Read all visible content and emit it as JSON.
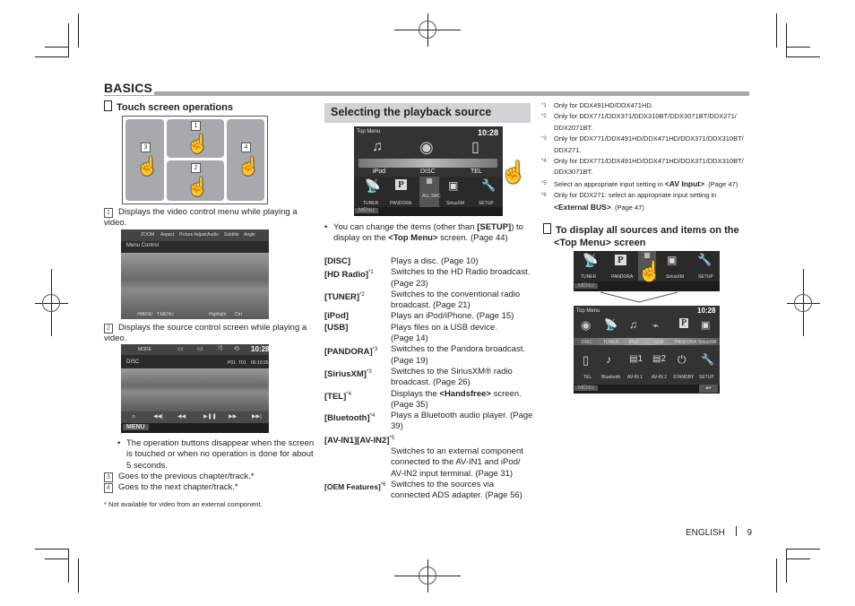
{
  "section_title": "BASICS",
  "touch": {
    "heading": "Touch screen operations",
    "zone_labels": [
      "1",
      "2",
      "3",
      "4"
    ],
    "items": [
      {
        "num": "1",
        "text": "Displays the video control menu while playing a video."
      },
      {
        "num": "2",
        "text": "Displays the source control screen while playing a video."
      },
      {
        "num": "3",
        "text": "Goes to the previous chapter/track.*"
      },
      {
        "num": "4",
        "text": "Goes to the next chapter/track.*"
      }
    ],
    "bullet": "The operation buttons disappear when the screen is touched or when no operation is done for about 5 seconds.",
    "footnote": "* Not available for video from an external component.",
    "video_menu_screen": {
      "tabs": [
        "ZOOM",
        "Aspect",
        "Picture Adjust",
        "Audio",
        "Subtitle",
        "Angle"
      ],
      "title": "Menu Control",
      "bottom": [
        "#MENU",
        "T.MENU",
        "Highlight",
        "Ctrl"
      ]
    },
    "source_screen": {
      "mode_label": "MODE",
      "clock": "10:28",
      "source": "DISC",
      "status": [
        "P01",
        "T01",
        "00:10:25"
      ],
      "menu_label": "MENU",
      "controls": [
        "search",
        "prev-track",
        "rewind",
        "play-pause",
        "fast-forward",
        "next-track"
      ]
    }
  },
  "playback": {
    "heading": "Selecting the playback source",
    "screen": {
      "title": "Top Menu",
      "clock": "10:28",
      "top_items": [
        "iPod",
        "DISC",
        "TEL"
      ],
      "bottom_items": [
        "TUNER",
        "PANDORA",
        "ALL SRC",
        "SiriusXM",
        "SETUP"
      ],
      "menu_label": "MENU"
    },
    "note_parts": [
      "You can change the items (other than ",
      "[SETUP]",
      ") to display on the ",
      "<Top Menu>",
      " screen. (Page 44)"
    ],
    "definitions": [
      {
        "term": "[DISC]",
        "mark": "",
        "desc": "Plays a disc. (Page 10)"
      },
      {
        "term": "[HD Radio]",
        "mark": "*1",
        "desc": "Switches to the HD Radio broadcast. (Page 23)"
      },
      {
        "term": "[TUNER]",
        "mark": "*2",
        "desc": "Switches to the conventional radio broadcast. (Page 21)"
      },
      {
        "term": "[iPod]",
        "mark": "",
        "desc": "Plays an iPod/iPhone. (Page 15)"
      },
      {
        "term": "[USB]",
        "mark": "",
        "desc": "Plays files on a USB device. (Page 14)"
      },
      {
        "term": "[PANDORA]",
        "mark": "*3",
        "desc": "Switches to the Pandora broadcast. (Page 19)"
      },
      {
        "term": "[SiriusXM]",
        "mark": "*3",
        "desc": "Switches to the SiriusXM® radio broadcast. (Page 26)"
      },
      {
        "term": "[TEL]",
        "mark": "*4",
        "desc_parts": [
          "Displays the ",
          "<Handsfree>",
          " screen. (Page 35)"
        ]
      },
      {
        "term": "[Bluetooth]",
        "mark": "*4",
        "desc": "Plays a Bluetooth audio player. (Page 39)"
      },
      {
        "term": "[AV-IN1][AV-IN2]",
        "mark": "*5",
        "desc": "Switches to an external component connected to the AV-IN1 and iPod/ AV-IN2 input terminal. (Page 31)"
      },
      {
        "term": "[OEM Features]",
        "mark": "*6",
        "desc": "Switches to the sources via connected ADS adapter. (Page 56)"
      }
    ]
  },
  "footnotes": [
    {
      "mark": "*1",
      "text": "Only for DDX491HD/DDX471HD."
    },
    {
      "mark": "*2",
      "text": "Only for DDX771/DDX371/DDX310BT/DDX3071BT/DDX271/ DDX2071BT."
    },
    {
      "mark": "*3",
      "text": "Only for DDX771/DDX491HD/DDX471HD/DDX371/DDX310BT/ DDX271."
    },
    {
      "mark": "*4",
      "text": "Only for DDX771/DDX491HD/DDX471HD/DDX371/DDX310BT/ DDX3071BT."
    },
    {
      "mark": "*5",
      "parts": [
        "Select an appropriate input setting in ",
        "<AV Input>",
        ". (Page 47)"
      ]
    },
    {
      "mark": "*6",
      "parts": [
        "Only for DDX271: select an appropriate input setting in ",
        "<External BUS>",
        ". (Page 47)"
      ]
    }
  ],
  "all_sources": {
    "heading": "To display all sources and items on the <Top Menu> screen",
    "strip_items": [
      "TUNER",
      "PANDORA",
      "ALL SRC",
      "SiriusXM",
      "SETUP"
    ],
    "menu_label": "MENU",
    "full_screen": {
      "title": "Top Menu",
      "clock": "10:28",
      "row1": [
        "DISC",
        "TUNER",
        "iPod",
        "USB",
        "PANDORA",
        "SiriusXM"
      ],
      "row2": [
        "TEL",
        "Bluetooth",
        "AV-IN 1",
        "AV-IN 2",
        "STANDBY",
        "SETUP"
      ],
      "menu_label": "MENU",
      "back_icon": "return-arrow-icon"
    }
  },
  "footer": {
    "language": "ENGLISH",
    "page": "9"
  }
}
